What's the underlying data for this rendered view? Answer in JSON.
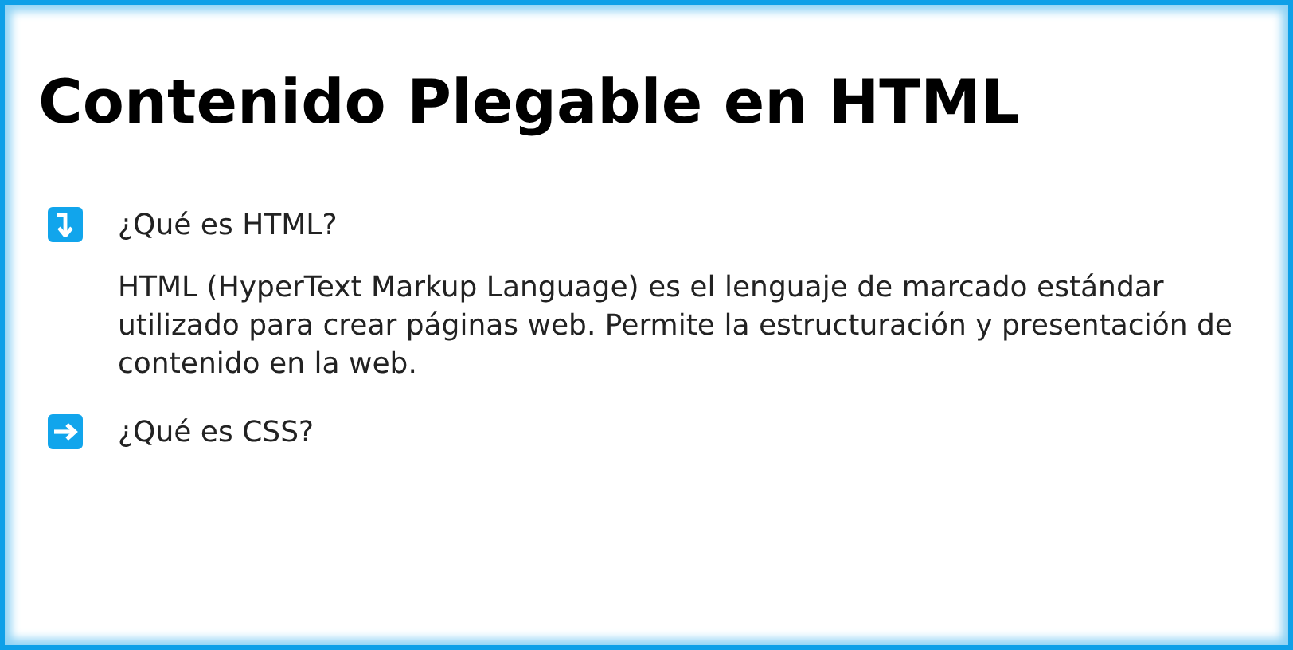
{
  "title": "Contenido Plegable en HTML",
  "sections": [
    {
      "question": "¿Qué es HTML?",
      "expanded": true,
      "answer": "HTML (HyperText Markup Language) es el lenguaje de marcado estándar utilizado para crear páginas web. Permite la estructuración y presentación de contenido en la web."
    },
    {
      "question": "¿Qué es CSS?",
      "expanded": false
    }
  ]
}
